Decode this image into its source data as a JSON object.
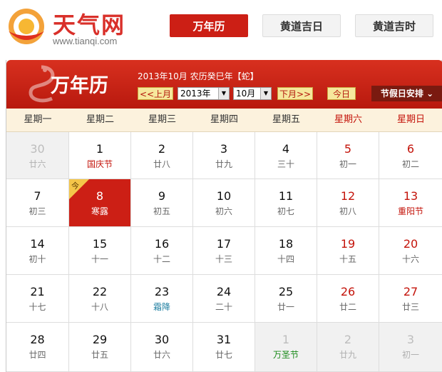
{
  "header": {
    "brand": "天气网",
    "url": "www.tianqi.com",
    "tabs": [
      {
        "label": "万年历",
        "active": true
      },
      {
        "label": "黄道吉日",
        "active": false
      },
      {
        "label": "黄道吉时",
        "active": false
      }
    ]
  },
  "calendar": {
    "title": "万年历",
    "lunar_info": "2013年10月 农历癸巳年【蛇】",
    "prev_btn": "<<上月",
    "year_value": "2013年",
    "month_value": "10月",
    "next_btn": "下月>>",
    "today_btn": "今日",
    "holiday_btn": "节假日安排",
    "weekdays": [
      "星期一",
      "星期二",
      "星期三",
      "星期四",
      "星期五",
      "星期六",
      "星期日"
    ],
    "today_badge": "今",
    "weeks": [
      [
        {
          "d": "30",
          "l": "廿六",
          "out": true
        },
        {
          "d": "1",
          "l": "国庆节",
          "fest": true
        },
        {
          "d": "2",
          "l": "廿八"
        },
        {
          "d": "3",
          "l": "廿九"
        },
        {
          "d": "4",
          "l": "三十"
        },
        {
          "d": "5",
          "l": "初一",
          "we": true
        },
        {
          "d": "6",
          "l": "初二",
          "we": true
        }
      ],
      [
        {
          "d": "7",
          "l": "初三"
        },
        {
          "d": "8",
          "l": "寒露",
          "today": true
        },
        {
          "d": "9",
          "l": "初五"
        },
        {
          "d": "10",
          "l": "初六"
        },
        {
          "d": "11",
          "l": "初七"
        },
        {
          "d": "12",
          "l": "初八",
          "we": true
        },
        {
          "d": "13",
          "l": "重阳节",
          "we": true,
          "fest": true
        }
      ],
      [
        {
          "d": "14",
          "l": "初十"
        },
        {
          "d": "15",
          "l": "十一"
        },
        {
          "d": "16",
          "l": "十二"
        },
        {
          "d": "17",
          "l": "十三"
        },
        {
          "d": "18",
          "l": "十四"
        },
        {
          "d": "19",
          "l": "十五",
          "we": true
        },
        {
          "d": "20",
          "l": "十六",
          "we": true
        }
      ],
      [
        {
          "d": "21",
          "l": "十七"
        },
        {
          "d": "22",
          "l": "十八"
        },
        {
          "d": "23",
          "l": "霜降",
          "term": true
        },
        {
          "d": "24",
          "l": "二十"
        },
        {
          "d": "25",
          "l": "廿一"
        },
        {
          "d": "26",
          "l": "廿二",
          "we": true
        },
        {
          "d": "27",
          "l": "廿三",
          "we": true
        }
      ],
      [
        {
          "d": "28",
          "l": "廿四"
        },
        {
          "d": "29",
          "l": "廿五"
        },
        {
          "d": "30",
          "l": "廿六"
        },
        {
          "d": "31",
          "l": "廿七"
        },
        {
          "d": "1",
          "l": "万圣节",
          "out": true,
          "fest2": true
        },
        {
          "d": "2",
          "l": "廿九",
          "out": true
        },
        {
          "d": "3",
          "l": "初一",
          "out": true
        }
      ]
    ]
  },
  "colors": {
    "accent_red": "#cc1f15",
    "weekend_red": "#c4140b",
    "solar_term_blue": "#1e7ea0",
    "festival_green": "#1a8a1a",
    "weekday_header_bg": "#fcf2dd"
  }
}
